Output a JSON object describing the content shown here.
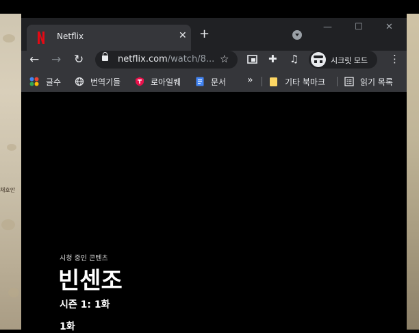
{
  "tab": {
    "title": "Netflix"
  },
  "omnibox": {
    "url_host": "netflix.com",
    "url_path": "/watch/8..."
  },
  "profile": {
    "label": "시크릿 모드"
  },
  "bookmarks": [
    {
      "label": "글수",
      "icon": "apps-icon"
    },
    {
      "label": "번역기들",
      "icon": "globe-icon"
    },
    {
      "label": "로아일퀘",
      "icon": "shield-icon"
    },
    {
      "label": "문서",
      "icon": "docs-icon"
    }
  ],
  "bookmarks_more": {
    "overflow": "»",
    "other": "기타 북마크",
    "reading": "읽기 목록"
  },
  "player": {
    "status": "시청 중인 콘텐츠",
    "title": "빈센조",
    "season": "시즌 1: 1화",
    "episode": "1화"
  },
  "desktop": {
    "map_label": "채호안"
  },
  "colors": {
    "netflix_red": "#e50914",
    "toolbar": "#35363a",
    "titlebar": "#202124"
  }
}
